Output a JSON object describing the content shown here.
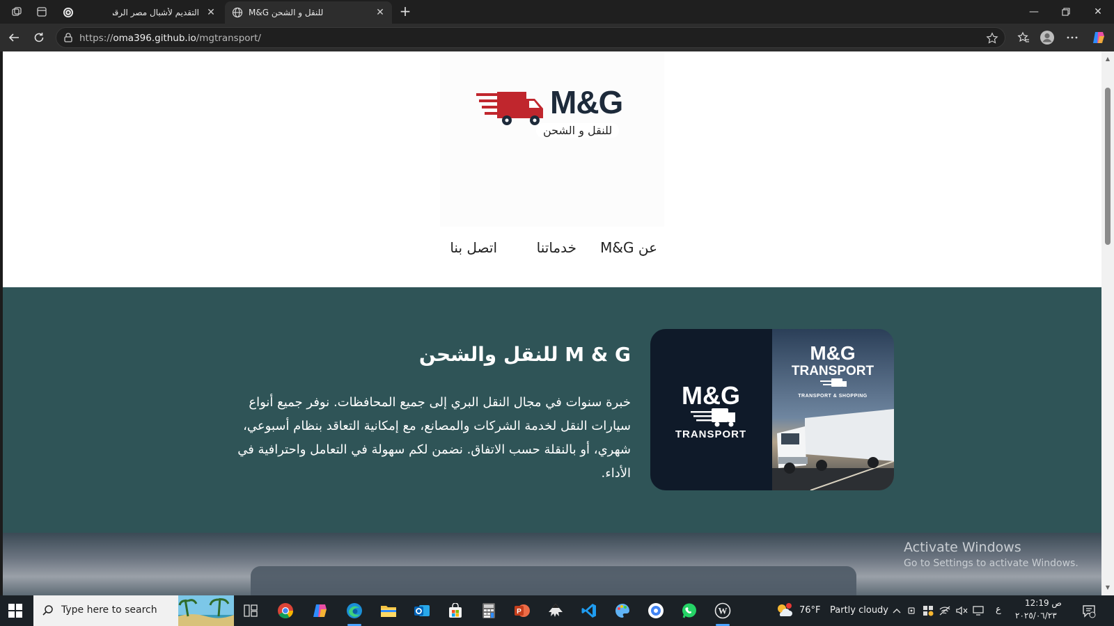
{
  "browser": {
    "tabs": [
      {
        "title": "التقديم لأشبال مصر الرقمية",
        "active": false
      },
      {
        "title": "M&G للنقل و الشحن",
        "active": true
      }
    ],
    "url_prefix": "https://",
    "url_host": "oma396.github.io",
    "url_path": "/mgtransport/"
  },
  "site": {
    "logo_text": "M&G",
    "logo_sub": "للنقل و الشحن",
    "nav": [
      "عن M&G",
      "خدماتنا",
      "اتصل بنا"
    ],
    "hero_title": "M & G للنقل والشحن",
    "hero_text": "خبرة سنوات في مجال النقل البري إلى جميع المحافظات. نوفر جميع أنواع سيارات النقل لخدمة الشركات والمصانع، مع إمكانية التعاقد بنظام أسبوعي، شهري، أو بالنقلة حسب الاتفاق. نضمن لكم سهولة في التعامل واحترافية في الأداء.",
    "hero_image": {
      "left_brand": "M&G",
      "left_sub": "TRANSPORT",
      "right_brand": "M&G",
      "right_sub": "TRANSPORT",
      "right_tag": "TRANSPORT & SHOPPING"
    },
    "colors": {
      "hero_bg": "#2f5457",
      "logo_red": "#c0262d",
      "logo_navy": "#1d2a3a"
    }
  },
  "watermark": {
    "line1": "Activate Windows",
    "line2": "Go to Settings to activate Windows."
  },
  "taskbar": {
    "search_placeholder": "Type here to search",
    "apps": [
      "task-view",
      "chrome",
      "copilot",
      "edge",
      "file-explorer",
      "outlook",
      "store",
      "calculator",
      "powerpoint",
      "inkscape",
      "vscode",
      "paint",
      "google-app",
      "whatsapp",
      "wordpress"
    ],
    "weather_temp": "76°F",
    "weather_text": "Partly cloudy",
    "lang": "ع",
    "time": "12:19 ص",
    "date": "٢٠٢٥/٠٦/٢٣"
  }
}
